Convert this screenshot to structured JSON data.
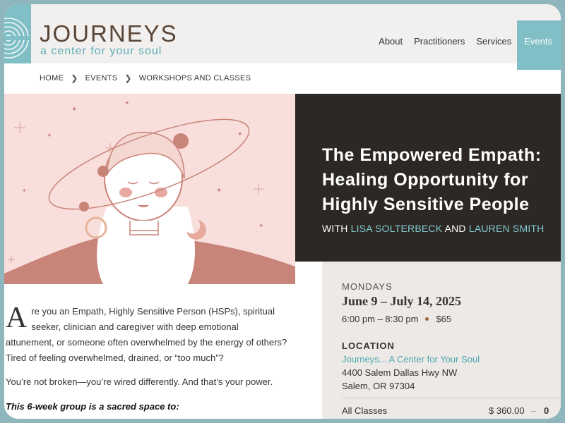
{
  "header": {
    "logo_title": "JOURNEYS",
    "logo_subtitle": "a center for your soul"
  },
  "nav": {
    "items": [
      {
        "label": "About"
      },
      {
        "label": "Practitioners"
      },
      {
        "label": "Services"
      },
      {
        "label": "Events"
      }
    ],
    "active": "Events"
  },
  "breadcrumb": [
    "HOME",
    "EVENTS",
    "WORKSHOPS AND CLASSES"
  ],
  "hero": {
    "title": "The Empowered Empath: Healing Opportunity for Highly Sensitive People",
    "with_prefix": "WITH",
    "presenter1": "LISA SOLTERBECK",
    "and": "AND",
    "presenter2": "LAUREN SMITH"
  },
  "event": {
    "day": "MONDAYS",
    "dates": "June 9 – July 14, 2025",
    "time": "6:00 pm – 8:30 pm",
    "price": "$65",
    "location_heading": "LOCATION",
    "location_name": "Journeys... A Center for Your Soul",
    "address_line1": "4400 Salem Dallas Hwy NW",
    "address_line2": "Salem, OR 97304",
    "ticket_label": "All Classes",
    "ticket_price": "$ 360.00",
    "ticket_dash": "–",
    "ticket_qty": "0"
  },
  "content": {
    "dropcap": "A",
    "intro": "re you an Empath, Highly Sensitive Person (HSPs), spiritual seeker, clinician and caregiver with deep emotional attunement, or someone often overwhelmed by the energy of others? Tired of feeling overwhelmed, drained, or “too much”?",
    "p2": "You’re not broken—you’re wired differently. And that’s your power.",
    "p3": "This 6-week group is a sacred space to:"
  },
  "colors": {
    "teal": "#7fbfc5",
    "dark": "#2d2824",
    "pink": "#f9dfdc",
    "rose": "#c9847a"
  }
}
